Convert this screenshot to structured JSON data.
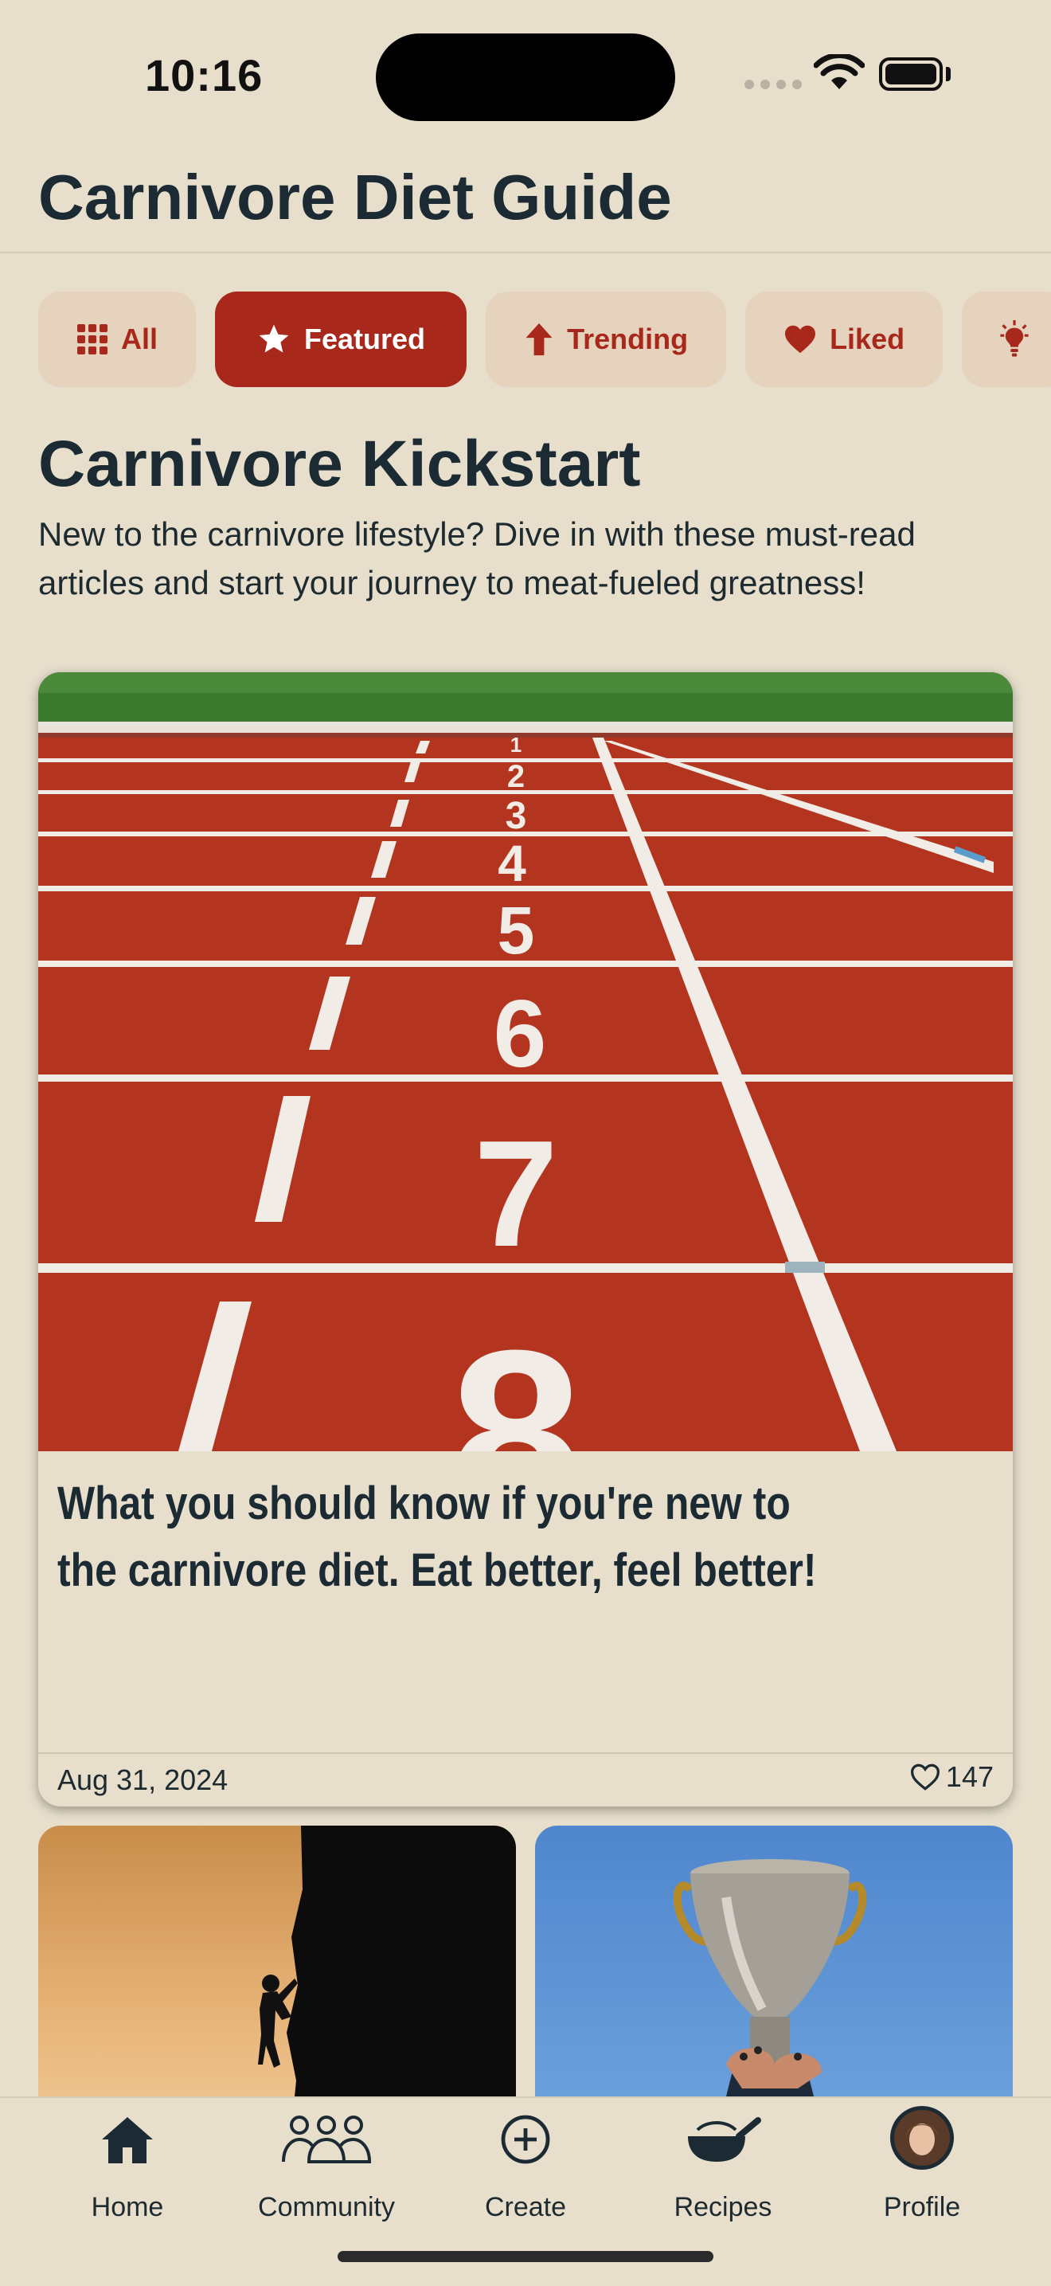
{
  "status_bar": {
    "time": "10:16"
  },
  "header": {
    "title": "Carnivore Diet Guide"
  },
  "filters": [
    {
      "label": "All",
      "icon": "grid-icon",
      "active": false
    },
    {
      "label": "Featured",
      "icon": "star-icon",
      "active": true
    },
    {
      "label": "Trending",
      "icon": "arrow-up-icon",
      "active": false
    },
    {
      "label": "Liked",
      "icon": "heart-icon",
      "active": false
    },
    {
      "label": "",
      "icon": "lightbulb-icon",
      "active": false
    }
  ],
  "section": {
    "title": "Carnivore Kickstart",
    "description": "New to the carnivore lifestyle? Dive in with these must-read articles and start your journey to meat-fueled greatness!"
  },
  "featured_article": {
    "headline": "What you should know if you're new to the carnivore diet. Eat better, feel better!",
    "date": "Aug 31, 2024",
    "likes": "147",
    "image": "running-track-lanes"
  },
  "more_articles": [
    {
      "image": "climber-silhouette-sunset"
    },
    {
      "image": "trophy-held-up-blue-sky"
    }
  ],
  "tab_bar": [
    {
      "label": "Home",
      "icon": "home-icon"
    },
    {
      "label": "Community",
      "icon": "community-icon"
    },
    {
      "label": "Create",
      "icon": "plus-circle-icon"
    },
    {
      "label": "Recipes",
      "icon": "pan-icon"
    },
    {
      "label": "Profile",
      "icon": "avatar"
    }
  ],
  "colors": {
    "accent": "#a8291c",
    "background": "#e7dfcc",
    "chip": "#e6d3bd",
    "text": "#1b2a33"
  }
}
